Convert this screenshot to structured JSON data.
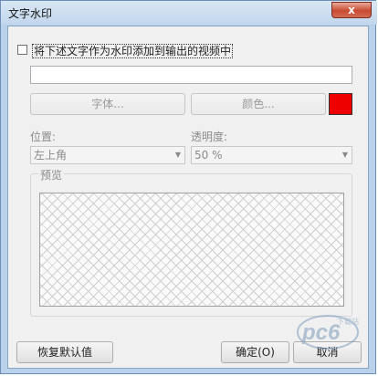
{
  "window": {
    "title": "文字水印",
    "close_label": "x"
  },
  "checkbox": {
    "label": "将下述文字作为水印添加到输出的视频中",
    "checked": false
  },
  "text_input": {
    "value": ""
  },
  "buttons": {
    "font": "字体...",
    "color": "颜色...",
    "reset": "恢复默认值",
    "ok": "确定(O)",
    "cancel": "取消"
  },
  "color": {
    "swatch": "#ee0000"
  },
  "position": {
    "label": "位置:",
    "value": "左上角"
  },
  "opacity": {
    "label": "透明度:",
    "value": "50 %"
  },
  "preview": {
    "label": "预览"
  },
  "watermark": {
    "text": "pc6",
    "sub": "下载站"
  }
}
